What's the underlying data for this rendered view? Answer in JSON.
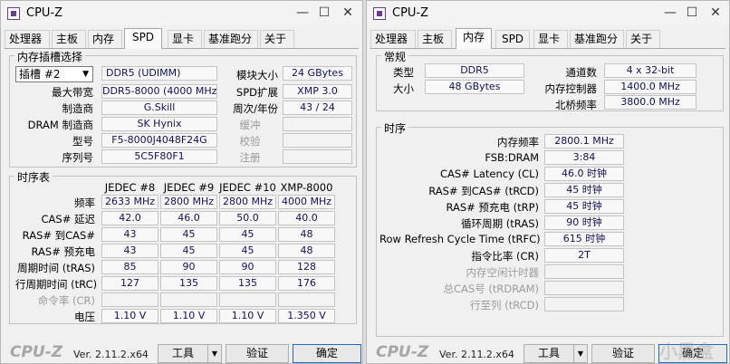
{
  "left": {
    "title": "CPU-Z",
    "tabs": [
      "处理器",
      "主板",
      "内存",
      "SPD",
      "显卡",
      "基准跑分",
      "关于"
    ],
    "active_tab": "SPD",
    "slot_group": {
      "title": "内存插槽选择",
      "slot_select": "插槽 #2",
      "fields": [
        {
          "label": "最大带宽",
          "value": "DDR5-8000 (4000 MHz)"
        },
        {
          "label": "制造商",
          "value": "G.Skill"
        },
        {
          "label": "DRAM 制造商",
          "value": "SK Hynix"
        },
        {
          "label": "型号",
          "value": "F5-8000J4048F24G"
        },
        {
          "label": "序列号",
          "value": "5C5F80F1"
        }
      ],
      "type_value": "DDR5 (UDIMM)",
      "right_fields": [
        {
          "label": "模块大小",
          "value": "24 GBytes"
        },
        {
          "label": "SPD扩展",
          "value": "XMP 3.0"
        },
        {
          "label": "周次/年份",
          "value": "43 / 24"
        },
        {
          "label": "缓冲",
          "value": ""
        },
        {
          "label": "校验",
          "value": ""
        },
        {
          "label": "注册",
          "value": ""
        }
      ]
    },
    "timings_group": {
      "title": "时序表",
      "headers": [
        "JEDEC #8",
        "JEDEC #9",
        "JEDEC #10",
        "XMP-8000"
      ],
      "rows": [
        {
          "label": "频率",
          "values": [
            "2633 MHz",
            "2800 MHz",
            "2800 MHz",
            "4000 MHz"
          ],
          "gray": false
        },
        {
          "label": "CAS# 延迟",
          "values": [
            "42.0",
            "46.0",
            "50.0",
            "40.0"
          ],
          "gray": false
        },
        {
          "label": "RAS# 到CAS#",
          "values": [
            "43",
            "45",
            "45",
            "48"
          ],
          "gray": false
        },
        {
          "label": "RAS# 预充电",
          "values": [
            "43",
            "45",
            "45",
            "48"
          ],
          "gray": false
        },
        {
          "label": "周期时间 (tRAS)",
          "values": [
            "85",
            "90",
            "90",
            "128"
          ],
          "gray": false
        },
        {
          "label": "行周期时间 (tRC)",
          "values": [
            "127",
            "135",
            "135",
            "176"
          ],
          "gray": false
        },
        {
          "label": "命令率 (CR)",
          "values": [
            "",
            "",
            "",
            ""
          ],
          "gray": true
        },
        {
          "label": "电压",
          "values": [
            "1.10 V",
            "1.10 V",
            "1.10 V",
            "1.350 V"
          ],
          "gray": false
        }
      ]
    },
    "footer": {
      "logo": "CPU-Z",
      "version": "Ver. 2.11.2.x64",
      "tools": "工具",
      "validate": "验证",
      "ok": "确定"
    }
  },
  "right": {
    "title": "CPU-Z",
    "tabs": [
      "处理器",
      "主板",
      "内存",
      "SPD",
      "显卡",
      "基准跑分",
      "关于"
    ],
    "active_tab": "内存",
    "general": {
      "title": "常规",
      "type_label": "类型",
      "type_value": "DDR5",
      "size_label": "大小",
      "size_value": "48 GBytes",
      "channels_label": "通道数",
      "channels_value": "4 x 32-bit",
      "mc_label": "内存控制器",
      "mc_value": "1400.0 MHz",
      "nb_label": "北桥频率",
      "nb_value": "3800.0 MHz"
    },
    "timings": {
      "title": "时序",
      "rows": [
        {
          "label": "内存频率",
          "value": "2800.1 MHz",
          "gray": false
        },
        {
          "label": "FSB:DRAM",
          "value": "3:84",
          "gray": false
        },
        {
          "label": "CAS# Latency (CL)",
          "value": "46.0 时钟",
          "gray": false
        },
        {
          "label": "RAS# 到CAS# (tRCD)",
          "value": "45 时钟",
          "gray": false
        },
        {
          "label": "RAS# 预充电 (tRP)",
          "value": "45 时钟",
          "gray": false
        },
        {
          "label": "循环周期 (tRAS)",
          "value": "90 时钟",
          "gray": false
        },
        {
          "label": "Row Refresh Cycle Time (tRFC)",
          "value": "615 时钟",
          "gray": false
        },
        {
          "label": "指令比率 (CR)",
          "value": "2T",
          "gray": false
        },
        {
          "label": "内存空闲计时器",
          "value": "",
          "gray": true
        },
        {
          "label": "总CAS号 (tRDRAM)",
          "value": "",
          "gray": true
        },
        {
          "label": "行至列 (tRCD)",
          "value": "",
          "gray": true
        }
      ]
    },
    "footer": {
      "logo": "CPU-Z",
      "version": "Ver. 2.11.2.x64",
      "tools": "工具",
      "validate": "验证",
      "ok": "确定"
    }
  },
  "watermark": "小黑盒"
}
